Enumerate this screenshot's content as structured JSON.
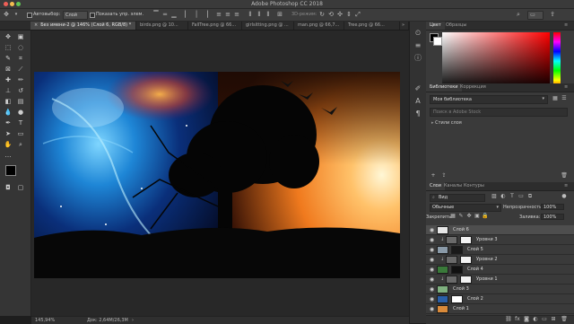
{
  "window": {
    "title": "Adobe Photoshop CC 2018"
  },
  "options_bar": {
    "autoselect_label": "Автовыбор:",
    "autoselect_value": "Слой",
    "show_controls_label": "Показать упр. элем.",
    "mode_3d_label": "3D-режим:"
  },
  "tabs": [
    {
      "label": "Без имени-2 @ 146% (Слой 6, RGB/8) *"
    },
    {
      "label": "birds.png @ 10..."
    },
    {
      "label": "FallTree.png @ 66..."
    },
    {
      "label": "girlsitting.png @ ..."
    },
    {
      "label": "man.png @ 66,7..."
    },
    {
      "label": "Tree.png @ 66..."
    }
  ],
  "status": {
    "zoom": "145,94%",
    "doc": "Док: 2,64M/26,3M"
  },
  "panels": {
    "color_tabs": [
      "Цвет",
      "Образцы"
    ],
    "library_tabs": [
      "Библиотеки",
      "Коррекция"
    ],
    "library_select": "Моя библиотека",
    "library_search_placeholder": "Поиск в Adobe Stock",
    "library_item": "Стили слоя",
    "layers_tabs": [
      "Слои",
      "Каналы",
      "Контуры"
    ],
    "filter_kind": "Вид",
    "blend_mode": "Обычные",
    "opacity_label": "Непрозрачность:",
    "opacity_value": "100%",
    "lock_label": "Закрепить:",
    "fill_label": "Заливка:",
    "fill_value": "100%"
  },
  "layers": [
    {
      "name": "Слой 6"
    },
    {
      "name": "Уровни 3"
    },
    {
      "name": "Слой 5"
    },
    {
      "name": "Уровни 2"
    },
    {
      "name": "Слой 4"
    },
    {
      "name": "Уровни 1"
    },
    {
      "name": "Слой 3"
    },
    {
      "name": "Слой 2"
    },
    {
      "name": "Слой 1"
    }
  ],
  "colors": {
    "accent_layer_selected": "#4e4e4e",
    "foreground": "#000000",
    "background": "#ffffff"
  }
}
